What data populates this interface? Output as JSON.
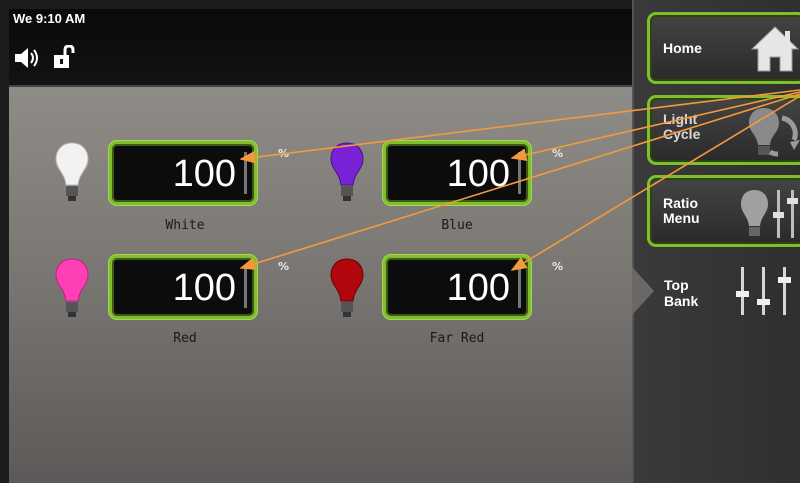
{
  "status": {
    "time": "We 9:10 AM"
  },
  "channels": [
    {
      "name": "White",
      "value": "100",
      "unit": "%",
      "color": "#f2f2f0"
    },
    {
      "name": "Blue",
      "value": "100",
      "unit": "%",
      "color": "#7a22d6"
    },
    {
      "name": "Red",
      "value": "100",
      "unit": "%",
      "color": "#ff3fb4"
    },
    {
      "name": "Far Red",
      "value": "100",
      "unit": "%",
      "color": "#b0060c"
    }
  ],
  "sidebar": {
    "home": "Home",
    "light_cycle": "Light\nCycle",
    "ratio_menu": "Ratio\nMenu",
    "top_bank": "Top\nBank"
  },
  "colors": {
    "accent_green": "#7fbf2e",
    "annotation_arrow": "#f39a3c"
  }
}
